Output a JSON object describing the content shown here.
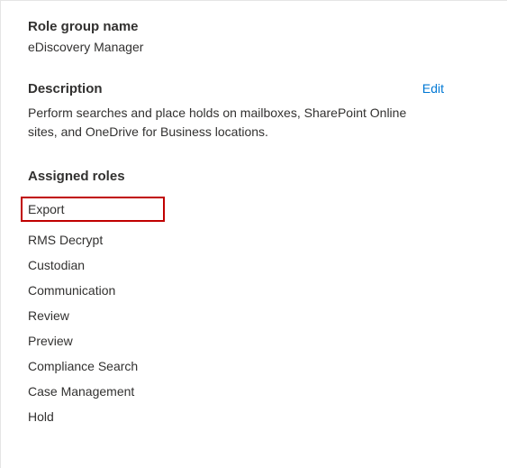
{
  "roleGroup": {
    "nameLabel": "Role group name",
    "nameValue": "eDiscovery Manager"
  },
  "description": {
    "label": "Description",
    "text": "Perform searches and place holds on mailboxes, SharePoint Online sites, and OneDrive for Business locations.",
    "editLabel": "Edit"
  },
  "assignedRoles": {
    "label": "Assigned roles",
    "items": [
      "Export",
      "RMS Decrypt",
      "Custodian",
      "Communication",
      "Review",
      "Preview",
      "Compliance Search",
      "Case Management",
      "Hold"
    ]
  }
}
